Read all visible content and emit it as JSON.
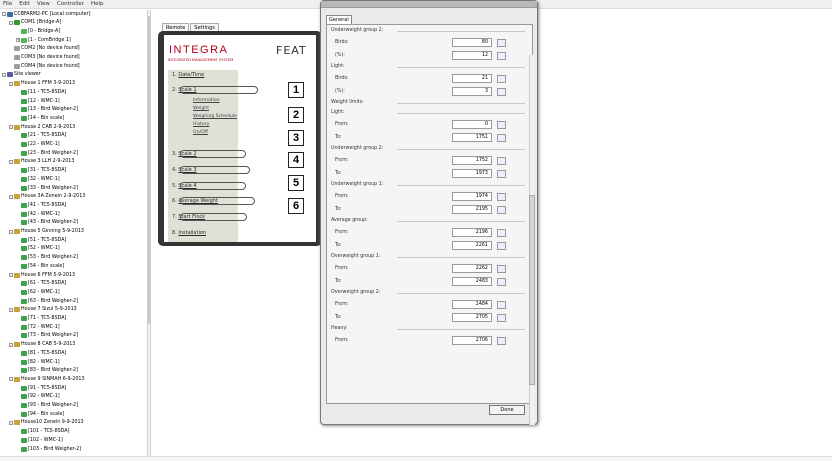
{
  "menubar": [
    "File",
    "Edit",
    "View",
    "Controller",
    "Help"
  ],
  "tree": [
    {
      "label": "CCBFARM2-PC [Local computer]",
      "indent": 0,
      "icon": "pc",
      "toggle": "-"
    },
    {
      "label": "COM1 [Bridge-A]",
      "indent": 1,
      "icon": "com",
      "toggle": "-"
    },
    {
      "label": "[0 - Bridge-A]",
      "indent": 2,
      "icon": "dev",
      "toggle": ""
    },
    {
      "label": "[1 - ComBridge 1]",
      "indent": 2,
      "icon": "dev",
      "toggle": "+"
    },
    {
      "label": "COM2 [No device found]",
      "indent": 1,
      "icon": "off",
      "toggle": ""
    },
    {
      "label": "COM3 [No device found]",
      "indent": 1,
      "icon": "off",
      "toggle": ""
    },
    {
      "label": "COM4 [No device found]",
      "indent": 1,
      "icon": "off",
      "toggle": ""
    },
    {
      "label": "Site viewer",
      "indent": 0,
      "icon": "site",
      "toggle": "-"
    },
    {
      "label": "House 1 FFM 3-9-2013",
      "indent": 1,
      "icon": "house",
      "toggle": "-"
    },
    {
      "label": "[11 - TC5-8SDA]",
      "indent": 2,
      "icon": "tc",
      "toggle": ""
    },
    {
      "label": "[12 - WMC-1]",
      "indent": 2,
      "icon": "tc",
      "toggle": ""
    },
    {
      "label": "[13 - Bird Weigher-2]",
      "indent": 2,
      "icon": "tc",
      "toggle": ""
    },
    {
      "label": "[14 - Bin scale]",
      "indent": 2,
      "icon": "tc",
      "toggle": ""
    },
    {
      "label": "House 2 CAB 2-9-2013",
      "indent": 1,
      "icon": "house",
      "toggle": "-"
    },
    {
      "label": "[21 - TC5-8SDA]",
      "indent": 2,
      "icon": "tc",
      "toggle": ""
    },
    {
      "label": "[22 - WMC-1]",
      "indent": 2,
      "icon": "tc",
      "toggle": ""
    },
    {
      "label": "[23 - Bird Weigher-2]",
      "indent": 2,
      "icon": "tc",
      "toggle": ""
    },
    {
      "label": "House 3 LLH 2-9-2013",
      "indent": 1,
      "icon": "house",
      "toggle": "-"
    },
    {
      "label": "[31 - TC5-8SDA]",
      "indent": 2,
      "icon": "tc",
      "toggle": ""
    },
    {
      "label": "[32 - WMC-1]",
      "indent": 2,
      "icon": "tc",
      "toggle": ""
    },
    {
      "label": "[33 - Bird Weigher-2]",
      "indent": 2,
      "icon": "tc",
      "toggle": ""
    },
    {
      "label": "House 3A Zenein 2-9-2013",
      "indent": 1,
      "icon": "house",
      "toggle": "-"
    },
    {
      "label": "[41 - TC5-8SDA]",
      "indent": 2,
      "icon": "tc",
      "toggle": ""
    },
    {
      "label": "[42 - WMC-1]",
      "indent": 2,
      "icon": "tc",
      "toggle": ""
    },
    {
      "label": "[43 - Bird Weigher-2]",
      "indent": 2,
      "icon": "tc",
      "toggle": ""
    },
    {
      "label": "House 5 Ginning 5-9-2013",
      "indent": 1,
      "icon": "house",
      "toggle": "-"
    },
    {
      "label": "[51 - TC5-8SDA]",
      "indent": 2,
      "icon": "tc",
      "toggle": ""
    },
    {
      "label": "[52 - WMC-1]",
      "indent": 2,
      "icon": "tc",
      "toggle": ""
    },
    {
      "label": "[53 - Bird Weigher-2]",
      "indent": 2,
      "icon": "tc",
      "toggle": ""
    },
    {
      "label": "[54 - Bin scale]",
      "indent": 2,
      "icon": "tc",
      "toggle": ""
    },
    {
      "label": "House 6 FFM 5-9-2013",
      "indent": 1,
      "icon": "house",
      "toggle": "-"
    },
    {
      "label": "[61 - TC5-8SDA]",
      "indent": 2,
      "icon": "tc",
      "toggle": ""
    },
    {
      "label": "[62 - WMC-1]",
      "indent": 2,
      "icon": "tc",
      "toggle": ""
    },
    {
      "label": "[63 - Bird Weigher-2]",
      "indent": 2,
      "icon": "tc",
      "toggle": ""
    },
    {
      "label": "House 7 Sizul 5-9-2013",
      "indent": 1,
      "icon": "house",
      "toggle": "-"
    },
    {
      "label": "[71 - TC5-8SDA]",
      "indent": 2,
      "icon": "tc",
      "toggle": ""
    },
    {
      "label": "[72 - WMC-1]",
      "indent": 2,
      "icon": "tc",
      "toggle": ""
    },
    {
      "label": "[73 - Bird Weigher-2]",
      "indent": 2,
      "icon": "tc",
      "toggle": ""
    },
    {
      "label": "House 8 CAB 5-9-2013",
      "indent": 1,
      "icon": "house",
      "toggle": "-"
    },
    {
      "label": "[81 - TC5-8SDA]",
      "indent": 2,
      "icon": "tc",
      "toggle": ""
    },
    {
      "label": "[82 - WMC-1]",
      "indent": 2,
      "icon": "tc",
      "toggle": ""
    },
    {
      "label": "[83 - Bird Weigher-2]",
      "indent": 2,
      "icon": "tc",
      "toggle": ""
    },
    {
      "label": "House 9 SINMAH 6-9-2013",
      "indent": 1,
      "icon": "house",
      "toggle": "-"
    },
    {
      "label": "[91 - TC5-8SDA]",
      "indent": 2,
      "icon": "tc",
      "toggle": ""
    },
    {
      "label": "[92 - WMC-1]",
      "indent": 2,
      "icon": "tc",
      "toggle": ""
    },
    {
      "label": "[93 - Bird Weigher-2]",
      "indent": 2,
      "icon": "tc",
      "toggle": ""
    },
    {
      "label": "[94 - Bin scale]",
      "indent": 2,
      "icon": "tc",
      "toggle": ""
    },
    {
      "label": "House10 Zenein 9-9-2013",
      "indent": 1,
      "icon": "house",
      "toggle": "-"
    },
    {
      "label": "[101 - TC5-8SDA]",
      "indent": 2,
      "icon": "tc",
      "toggle": ""
    },
    {
      "label": "[102 - WMC-1]",
      "indent": 2,
      "icon": "tc",
      "toggle": ""
    },
    {
      "label": "[103 - Bird Weigher-2]",
      "indent": 2,
      "icon": "tc",
      "toggle": ""
    }
  ],
  "tabs": [
    "Remote",
    "Settings"
  ],
  "logo": {
    "brand": "INTEGRA",
    "subtitle": "INTEGRATED MANAGEMENT SYSTEM",
    "product": "FEAT"
  },
  "nav": {
    "items": [
      {
        "num": "1.",
        "label": "Date/Time"
      },
      {
        "num": "2.",
        "label": "Scale 1"
      },
      {
        "num": "3.",
        "label": "Scale 2"
      },
      {
        "num": "4.",
        "label": "Scale 3"
      },
      {
        "num": "5.",
        "label": "Scale 4"
      },
      {
        "num": "6.",
        "label": "Average Weight"
      },
      {
        "num": "7.",
        "label": "Start Flock"
      },
      {
        "num": "8.",
        "label": "Installation"
      }
    ],
    "sub": [
      "Information",
      "Weight",
      "Weighing Schedule",
      "History",
      "On/Off"
    ],
    "steps": [
      "1",
      "2",
      "3",
      "4",
      "5",
      "6"
    ]
  },
  "dialog": {
    "tab": "General",
    "done": "Done",
    "rows": [
      {
        "kind": "header",
        "text": "Underweight group 2:"
      },
      {
        "kind": "field",
        "label": "Birds:",
        "value": "80"
      },
      {
        "kind": "field",
        "label": "(%):",
        "value": "12"
      },
      {
        "kind": "header",
        "text": "Light:"
      },
      {
        "kind": "field",
        "label": "Birds:",
        "value": "21"
      },
      {
        "kind": "field",
        "label": "(%):",
        "value": "3"
      },
      {
        "kind": "header",
        "text": "Weight limits:"
      },
      {
        "kind": "header",
        "text": "Light:"
      },
      {
        "kind": "field",
        "label": "From:",
        "value": "0"
      },
      {
        "kind": "field",
        "label": "To:",
        "value": "1751"
      },
      {
        "kind": "header",
        "text": "Underweight group 2:"
      },
      {
        "kind": "field",
        "label": "From:",
        "value": "1752"
      },
      {
        "kind": "field",
        "label": "To:",
        "value": "1973"
      },
      {
        "kind": "header",
        "text": "Underweight group 1:"
      },
      {
        "kind": "field",
        "label": "From:",
        "value": "1974"
      },
      {
        "kind": "field",
        "label": "To:",
        "value": "2195"
      },
      {
        "kind": "header",
        "text": "Average group:"
      },
      {
        "kind": "field",
        "label": "From:",
        "value": "2196"
      },
      {
        "kind": "field",
        "label": "To:",
        "value": "2261"
      },
      {
        "kind": "header",
        "text": "Overweight group 1:"
      },
      {
        "kind": "field",
        "label": "From:",
        "value": "2262"
      },
      {
        "kind": "field",
        "label": "To:",
        "value": "2483"
      },
      {
        "kind": "header",
        "text": "Overweight group 2:"
      },
      {
        "kind": "field",
        "label": "From:",
        "value": "2484"
      },
      {
        "kind": "field",
        "label": "To:",
        "value": "2705"
      },
      {
        "kind": "header",
        "text": "Heavy:"
      },
      {
        "kind": "field",
        "label": "From:",
        "value": "2706"
      }
    ]
  }
}
